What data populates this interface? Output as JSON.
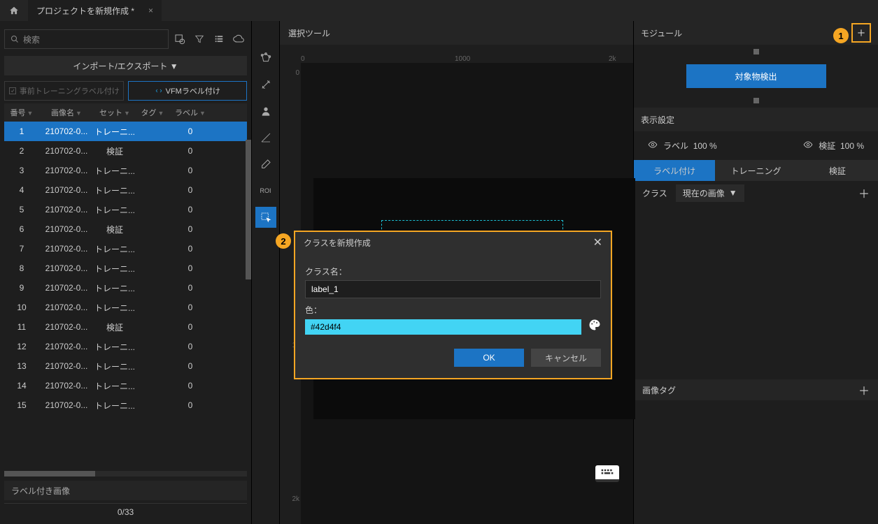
{
  "tabbar": {
    "title": "プロジェクトを新規作成 *",
    "close": "×"
  },
  "sidebar": {
    "search_placeholder": "検索",
    "import_export": "インポート/エクスポート ▼",
    "pretrain_btn": "事前トレーニングラベル付け",
    "vfm_btn": "VFMラベル付け",
    "headers": {
      "num": "番号",
      "img": "画像名",
      "set": "セット",
      "tag": "タグ",
      "lbl": "ラベル"
    },
    "rows": [
      {
        "n": "1",
        "img": "210702-0...",
        "set": "トレーニ...",
        "lbl": "0"
      },
      {
        "n": "2",
        "img": "210702-0...",
        "set": "検証",
        "lbl": "0"
      },
      {
        "n": "3",
        "img": "210702-0...",
        "set": "トレーニ...",
        "lbl": "0"
      },
      {
        "n": "4",
        "img": "210702-0...",
        "set": "トレーニ...",
        "lbl": "0"
      },
      {
        "n": "5",
        "img": "210702-0...",
        "set": "トレーニ...",
        "lbl": "0"
      },
      {
        "n": "6",
        "img": "210702-0...",
        "set": "検証",
        "lbl": "0"
      },
      {
        "n": "7",
        "img": "210702-0...",
        "set": "トレーニ...",
        "lbl": "0"
      },
      {
        "n": "8",
        "img": "210702-0...",
        "set": "トレーニ...",
        "lbl": "0"
      },
      {
        "n": "9",
        "img": "210702-0...",
        "set": "トレーニ...",
        "lbl": "0"
      },
      {
        "n": "10",
        "img": "210702-0...",
        "set": "トレーニ...",
        "lbl": "0"
      },
      {
        "n": "11",
        "img": "210702-0...",
        "set": "検証",
        "lbl": "0"
      },
      {
        "n": "12",
        "img": "210702-0...",
        "set": "トレーニ...",
        "lbl": "0"
      },
      {
        "n": "13",
        "img": "210702-0...",
        "set": "トレーニ...",
        "lbl": "0"
      },
      {
        "n": "14",
        "img": "210702-0...",
        "set": "トレーニ...",
        "lbl": "0"
      },
      {
        "n": "15",
        "img": "210702-0...",
        "set": "トレーニ...",
        "lbl": "0"
      }
    ],
    "labeled_header": "ラベル付き画像",
    "progress": "0/33"
  },
  "center": {
    "tool_header": "選択ツール",
    "roi_label": "ROI",
    "ruler_h": {
      "t0": "0",
      "t1": "1000",
      "t2": "2k"
    },
    "ruler_v": {
      "t0": "0",
      "t1": "1k",
      "t2": "2k"
    }
  },
  "right": {
    "module_header": "モジュール",
    "module_btn": "対象物検出",
    "display_header": "表示設定",
    "label_vis": "ラベル",
    "label_pct": "100  %",
    "verify_vis": "検証",
    "verify_pct": "100  %",
    "tabs": {
      "label": "ラベル付け",
      "train": "トレーニング",
      "verify": "検証"
    },
    "class_label": "クラス",
    "class_dd": "現在の画像",
    "tags_header": "画像タグ"
  },
  "dialog": {
    "title": "クラスを新規作成",
    "name_label": "クラス名：",
    "name_value": "label_1",
    "color_label": "色：",
    "color_value": "#42d4f4",
    "ok": "OK",
    "cancel": "キャンセル"
  },
  "callouts": {
    "c1": "1",
    "c2": "2"
  }
}
